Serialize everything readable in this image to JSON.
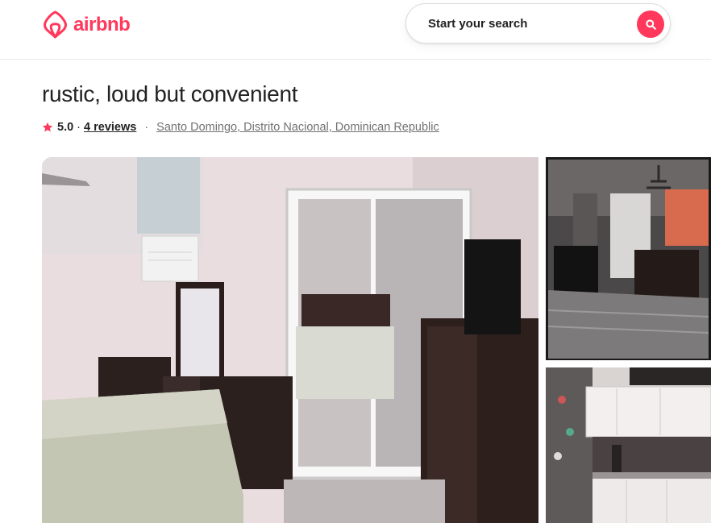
{
  "header": {
    "logo_text": "airbnb",
    "search_label": "Start your search"
  },
  "listing": {
    "title": "rustic, loud but convenient",
    "rating": "5.0",
    "rating_separator": "·",
    "reviews_link": "4 reviews",
    "location_separator": "·",
    "location": "Santo Domingo, Distrito Nacional, Dominican Republic"
  },
  "colors": {
    "brand": "#ff385c",
    "text": "#222222",
    "muted": "#717171"
  },
  "icons": {
    "logo": "airbnb-logo-icon",
    "search": "search-icon",
    "rating": "star-icon"
  }
}
